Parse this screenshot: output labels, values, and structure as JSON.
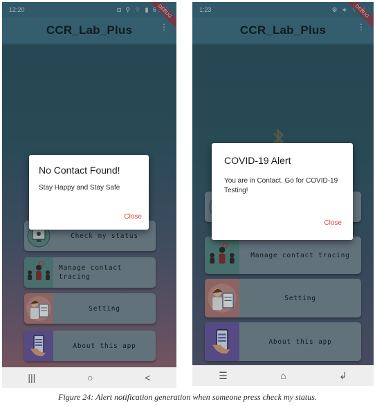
{
  "left": {
    "status_time": "12:20",
    "status_icons": "◘ ⚲ ⌔ ▮ 67%",
    "app_title": "CCR_Lab_Plus",
    "menu_glyph": "⋮",
    "debug_label": "DEBUG",
    "cards": [
      {
        "label": "Check my status",
        "icon": "monitor-person-icon"
      },
      {
        "label": "Manage contact tracing",
        "icon": "people-network-icon"
      },
      {
        "label": "Setting",
        "icon": "doctor-clipboard-icon"
      },
      {
        "label": "About this app",
        "icon": "phone-in-hand-icon"
      }
    ],
    "nav": {
      "recents": "|||",
      "home": "○",
      "back": "<"
    },
    "dialog": {
      "title": "No Contact Found!",
      "message": "Stay Happy and Stay Safe",
      "button": "Close"
    }
  },
  "right": {
    "status_time": "1:23",
    "status_icons": "⚙ ∗ ⌔ ▮",
    "app_title": "CCR_Lab_Plus",
    "menu_glyph": "⋮",
    "debug_label": "DEBUG",
    "cards": [
      {
        "label": "Manage contact tracing",
        "icon": "people-network-icon"
      },
      {
        "label": "Setting",
        "icon": "doctor-clipboard-icon"
      },
      {
        "label": "About this app",
        "icon": "phone-in-hand-icon"
      }
    ],
    "nav": {
      "menu": "☰",
      "home": "⌂",
      "back": "↲"
    },
    "dialog": {
      "title": "COVID-19 Alert",
      "message": "You are in Contact. Go for COVID-19 Testing!",
      "button": "Close"
    }
  },
  "caption": "Figure 24: Alert notification generation when someone press check my status."
}
